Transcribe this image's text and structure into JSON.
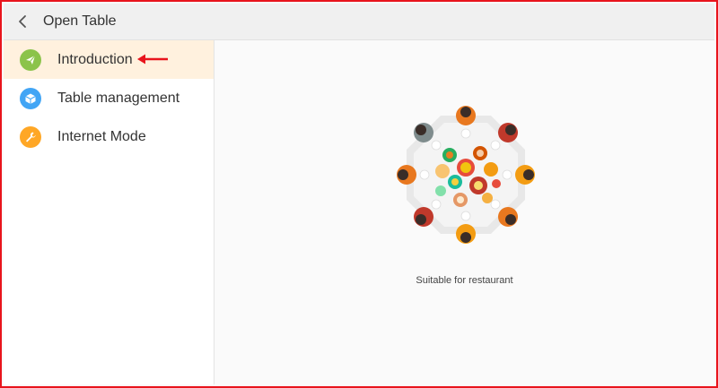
{
  "header": {
    "title": "Open Table",
    "back_icon": "chevron-left-icon"
  },
  "sidebar": {
    "items": [
      {
        "label": "Introduction",
        "icon": "send-icon",
        "icon_color": "#8bc34a",
        "active": true
      },
      {
        "label": "Table management",
        "icon": "cube-icon",
        "icon_color": "#42a5f5",
        "active": false
      },
      {
        "label": "Internet Mode",
        "icon": "wrench-icon",
        "icon_color": "#ffa726",
        "active": false
      }
    ]
  },
  "main": {
    "illustration": "round-dining-table-illustration",
    "caption": "Suitable for restaurant"
  },
  "colors": {
    "active_item_bg": "#fff1de",
    "annotation": "#e8141c",
    "header_bg": "#f0f0f0"
  }
}
